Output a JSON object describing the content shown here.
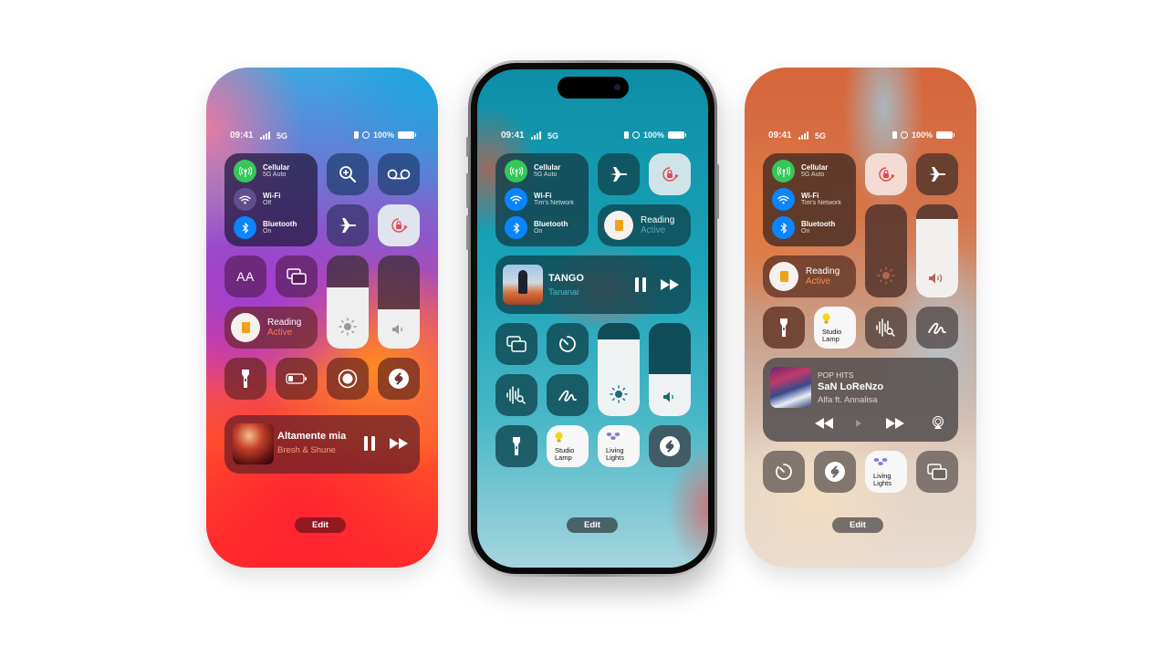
{
  "status_bar": {
    "time": "09:41",
    "network": "5G",
    "battery": "100%"
  },
  "colors": {
    "cellular_green": "#34c759",
    "wifi_blue": "#0a84ff",
    "bluetooth_blue": "#0a84ff",
    "rotation_lock_red": "#e5484d",
    "reading_active_orange": "#ff7a4a",
    "book_orange": "#f2a11a"
  },
  "phones": {
    "left": {
      "connectivity": {
        "cellular": {
          "label": "Cellular",
          "status": "5G Auto"
        },
        "wifi": {
          "label": "Wi-Fi",
          "status": "Off"
        },
        "bluetooth": {
          "label": "Bluetooth",
          "status": "On"
        }
      },
      "text_size_glyph": "AA",
      "reading": {
        "label": "Reading",
        "state": "Active"
      },
      "brightness_level": 0.66,
      "volume_level": 0.42,
      "now_playing": {
        "title": "Altamente mia",
        "artist": "Bresh & Shune"
      },
      "edit_label": "Edit"
    },
    "middle": {
      "connectivity": {
        "cellular": {
          "label": "Cellular",
          "status": "5G Auto"
        },
        "wifi": {
          "label": "Wi-Fi",
          "status": "Tim's Network"
        },
        "bluetooth": {
          "label": "Bluetooth",
          "status": "On"
        }
      },
      "reading": {
        "label": "Reading",
        "state": "Active"
      },
      "now_playing": {
        "title": "TANGO",
        "artist": "Tananai"
      },
      "brightness_level": 0.82,
      "volume_level": 0.45,
      "home": [
        {
          "label_line1": "Studio",
          "label_line2": "Lamp"
        },
        {
          "label_line1": "Living",
          "label_line2": "Lights"
        }
      ],
      "edit_label": "Edit"
    },
    "right": {
      "connectivity": {
        "cellular": {
          "label": "Cellular",
          "status": "5G Auto"
        },
        "wifi": {
          "label": "Wi-Fi",
          "status": "Tim's Network"
        },
        "bluetooth": {
          "label": "Bluetooth",
          "status": "On"
        }
      },
      "brightness_level": 0.0,
      "volume_level": 0.84,
      "reading": {
        "label": "Reading",
        "state": "Active"
      },
      "home": [
        {
          "label_line1": "Studio",
          "label_line2": "Lamp"
        },
        {
          "label_line1": "Living",
          "label_line2": "Lights"
        }
      ],
      "now_playing": {
        "playlist": "POP HITS",
        "title": "SaN LoReNzo",
        "artist": "Alfa ft. Annalisa"
      },
      "edit_label": "Edit"
    }
  }
}
